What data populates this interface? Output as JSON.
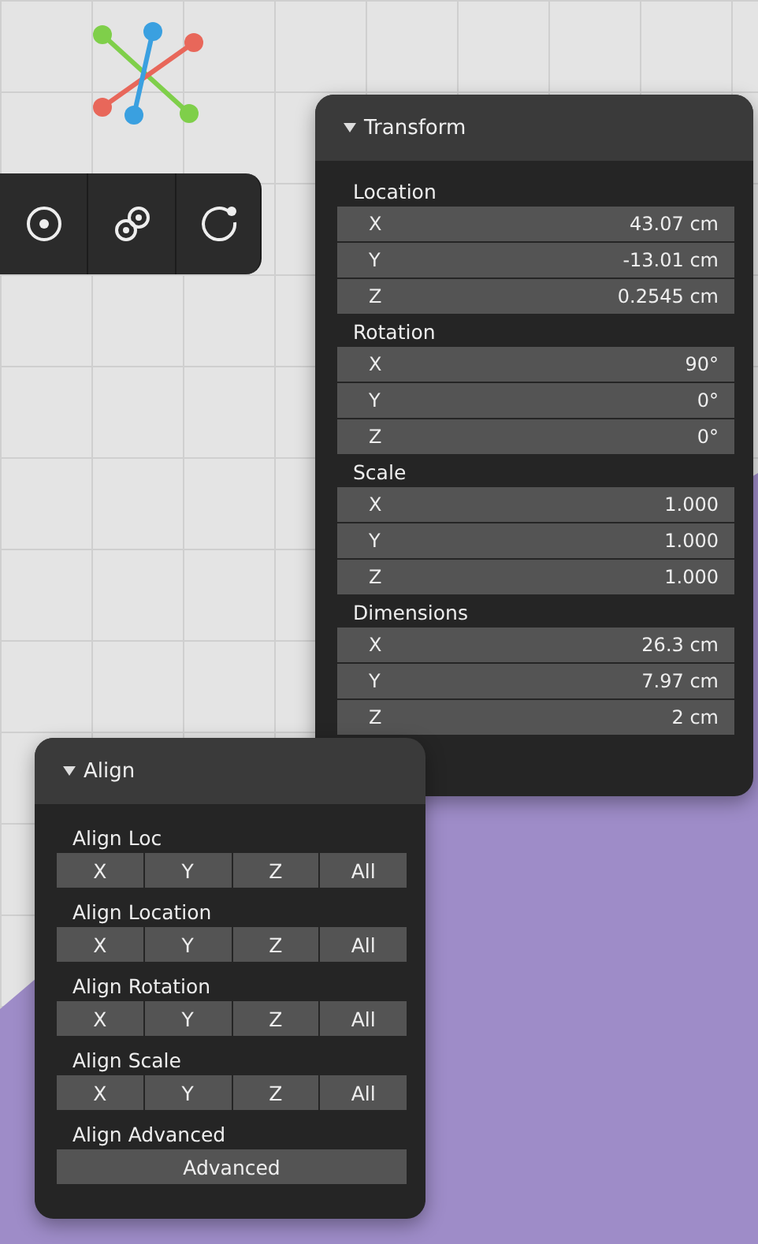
{
  "transform_panel": {
    "title": "Transform",
    "expanded": true,
    "groups": [
      {
        "label": "Location",
        "fields": [
          {
            "axis": "X",
            "value": "43.07 cm"
          },
          {
            "axis": "Y",
            "value": "-13.01 cm"
          },
          {
            "axis": "Z",
            "value": "0.2545 cm"
          }
        ]
      },
      {
        "label": "Rotation",
        "fields": [
          {
            "axis": "X",
            "value": "90°"
          },
          {
            "axis": "Y",
            "value": "0°"
          },
          {
            "axis": "Z",
            "value": "0°"
          }
        ]
      },
      {
        "label": "Scale",
        "fields": [
          {
            "axis": "X",
            "value": "1.000"
          },
          {
            "axis": "Y",
            "value": "1.000"
          },
          {
            "axis": "Z",
            "value": "1.000"
          }
        ]
      },
      {
        "label": "Dimensions",
        "fields": [
          {
            "axis": "X",
            "value": "26.3 cm"
          },
          {
            "axis": "Y",
            "value": "7.97 cm"
          },
          {
            "axis": "Z",
            "value": "2 cm"
          }
        ]
      }
    ]
  },
  "align_panel": {
    "title": "Align",
    "expanded": true,
    "groups": [
      {
        "label": "Align Loc",
        "buttons": [
          "X",
          "Y",
          "Z",
          "All"
        ]
      },
      {
        "label": "Align Location",
        "buttons": [
          "X",
          "Y",
          "Z",
          "All"
        ]
      },
      {
        "label": "Align Rotation",
        "buttons": [
          "X",
          "Y",
          "Z",
          "All"
        ]
      },
      {
        "label": "Align Scale",
        "buttons": [
          "X",
          "Y",
          "Z",
          "All"
        ]
      },
      {
        "label": "Align Advanced",
        "buttons": [
          "Advanced"
        ]
      }
    ]
  }
}
